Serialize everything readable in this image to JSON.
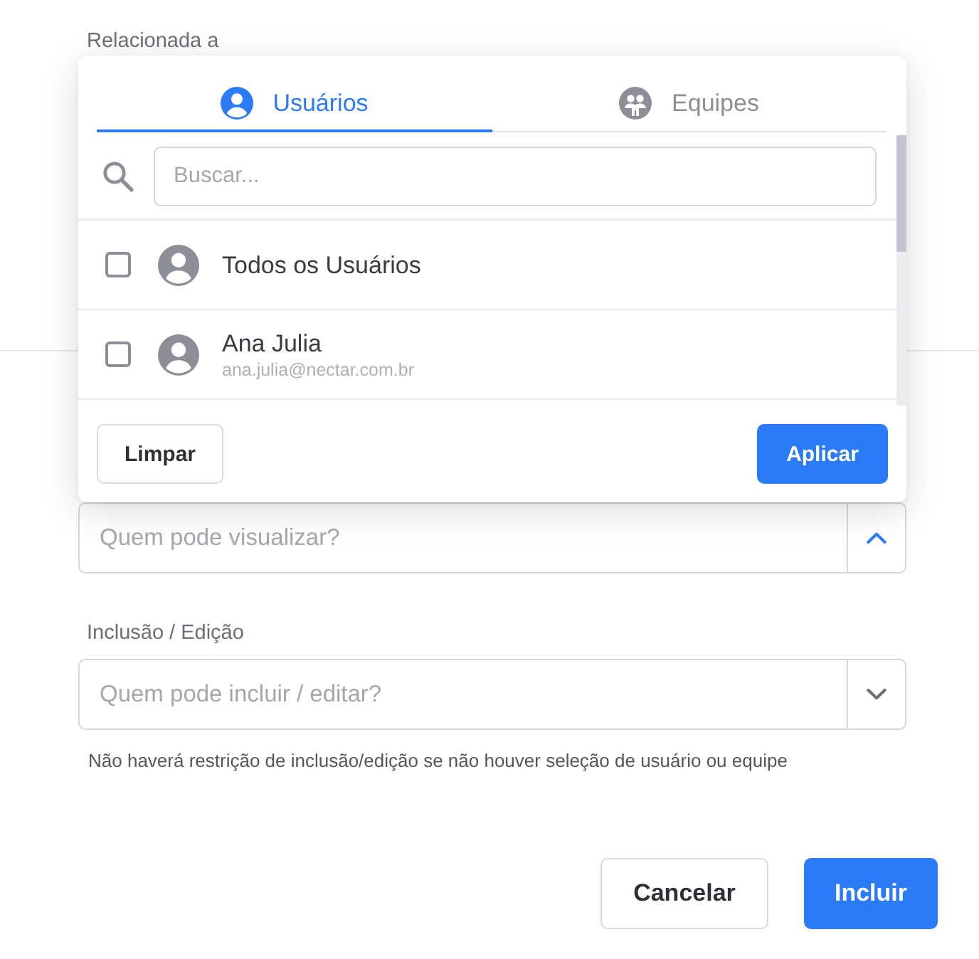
{
  "related_label": "Relacionada a",
  "popup": {
    "tabs": [
      {
        "label": "Usuários",
        "selected": true,
        "kind": "user"
      },
      {
        "label": "Equipes",
        "selected": false,
        "kind": "team"
      }
    ],
    "search": {
      "placeholder": "Buscar..."
    },
    "items": [
      {
        "name": "Todos os Usuários",
        "checked": false
      },
      {
        "name": "Ana Julia",
        "email": "ana.julia@nectar.com.br",
        "checked": false
      }
    ],
    "buttons": [
      {
        "label": "Limpar",
        "kind": "secondary"
      },
      {
        "label": "Aplicar",
        "kind": "primary"
      }
    ]
  },
  "fields": [
    {
      "placeholder": "Quem pode visualizar?",
      "expanded": true
    },
    {
      "label": "Inclusão / Edição",
      "placeholder": "Quem pode incluir / editar?",
      "expanded": false,
      "hint": "Não haverá restrição de inclusão/edição se não houver seleção de usuário ou equipe"
    }
  ],
  "buttons": [
    {
      "label": "Cancelar",
      "kind": "secondary"
    },
    {
      "label": "Incluir",
      "kind": "primary"
    }
  ]
}
